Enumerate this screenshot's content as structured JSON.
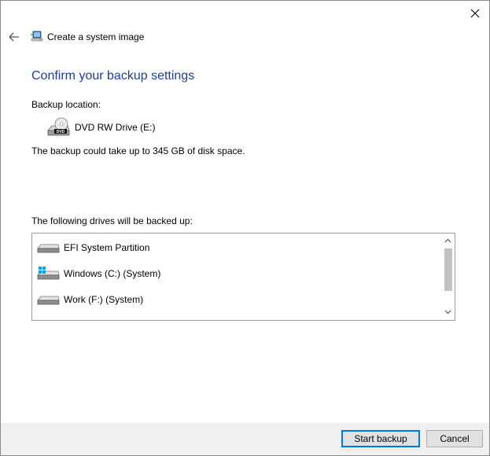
{
  "window": {
    "close_icon": "close-icon"
  },
  "header": {
    "back_icon": "back-arrow-icon",
    "app_icon": "system-image-icon",
    "title": "Create a system image"
  },
  "main": {
    "heading": "Confirm your backup settings",
    "location_label": "Backup location:",
    "location": {
      "icon": "dvd-drive-icon",
      "name": "DVD RW Drive (E:)"
    },
    "space_text": "The backup could take up to 345 GB of disk space.",
    "drives_label": "The following drives will be backed up:",
    "drives": [
      {
        "name": "EFI System Partition",
        "icon": "drive-icon"
      },
      {
        "name": "Windows (C:) (System)",
        "icon": "windows-drive-icon"
      },
      {
        "name": "Work (F:) (System)",
        "icon": "drive-icon"
      }
    ]
  },
  "footer": {
    "start_label": "Start backup",
    "cancel_label": "Cancel"
  },
  "colors": {
    "heading": "#1e3e9c",
    "footer_bg": "#f0f0f0",
    "primary_border": "#0078d7"
  }
}
